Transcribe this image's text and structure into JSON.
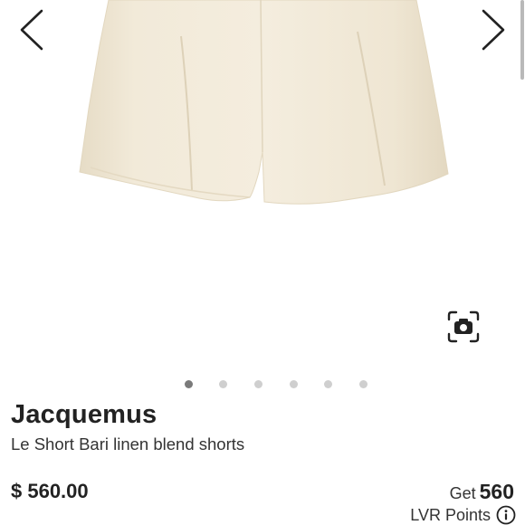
{
  "product": {
    "brand": "Jacquemus",
    "name": "Le Short Bari linen blend shorts",
    "price": "$ 560.00"
  },
  "loyalty": {
    "get_label": "Get",
    "points_value": "560",
    "points_label": "LVR Points"
  },
  "gallery": {
    "image_count": 6,
    "active_index": 0,
    "image_subject": "cream linen shorts",
    "colors": {
      "fabric": "#efe6d4",
      "active_dot": "#7a7a7a",
      "inactive_dot": "#cfcfcf"
    }
  },
  "icons": {
    "prev": "chevron-left-icon",
    "next": "chevron-right-icon",
    "camera": "camera-search-icon",
    "info": "info-icon"
  }
}
